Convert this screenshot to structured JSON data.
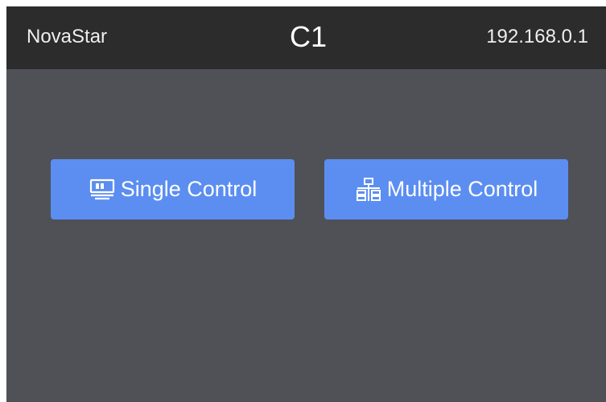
{
  "header": {
    "brand": "NovaStar",
    "device": "C1",
    "ip": "192.168.0.1"
  },
  "buttons": {
    "single_label": "Single Control",
    "multiple_label": "Multiple Control"
  },
  "icons": {
    "single": "monitor-control-icon",
    "multiple": "network-hierarchy-icon"
  },
  "colors": {
    "topbar": "#2c2c2d",
    "background": "#4f5156",
    "button": "#5b8ef0",
    "text": "#ffffff"
  }
}
